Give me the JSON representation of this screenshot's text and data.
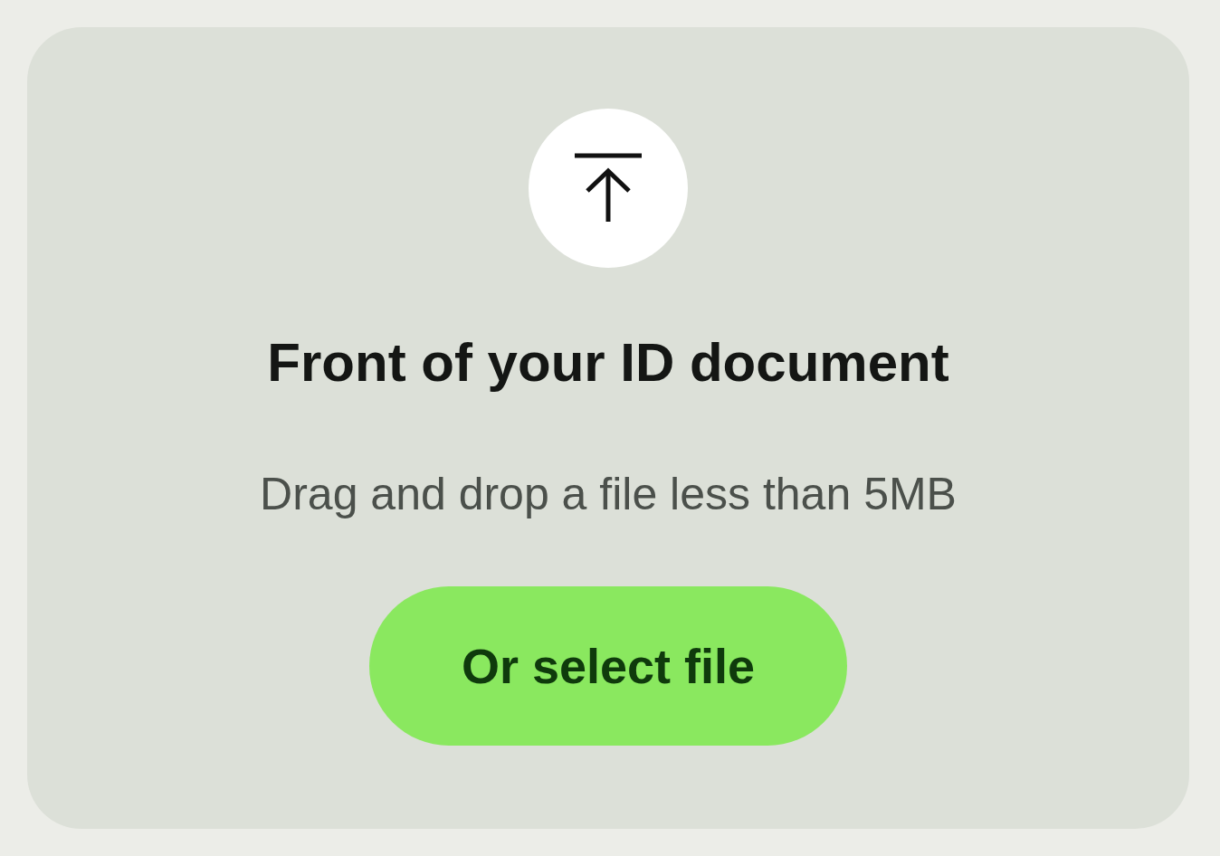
{
  "upload": {
    "title": "Front of your ID document",
    "hint": "Drag and drop a file less than 5MB",
    "button": "Or select file"
  }
}
